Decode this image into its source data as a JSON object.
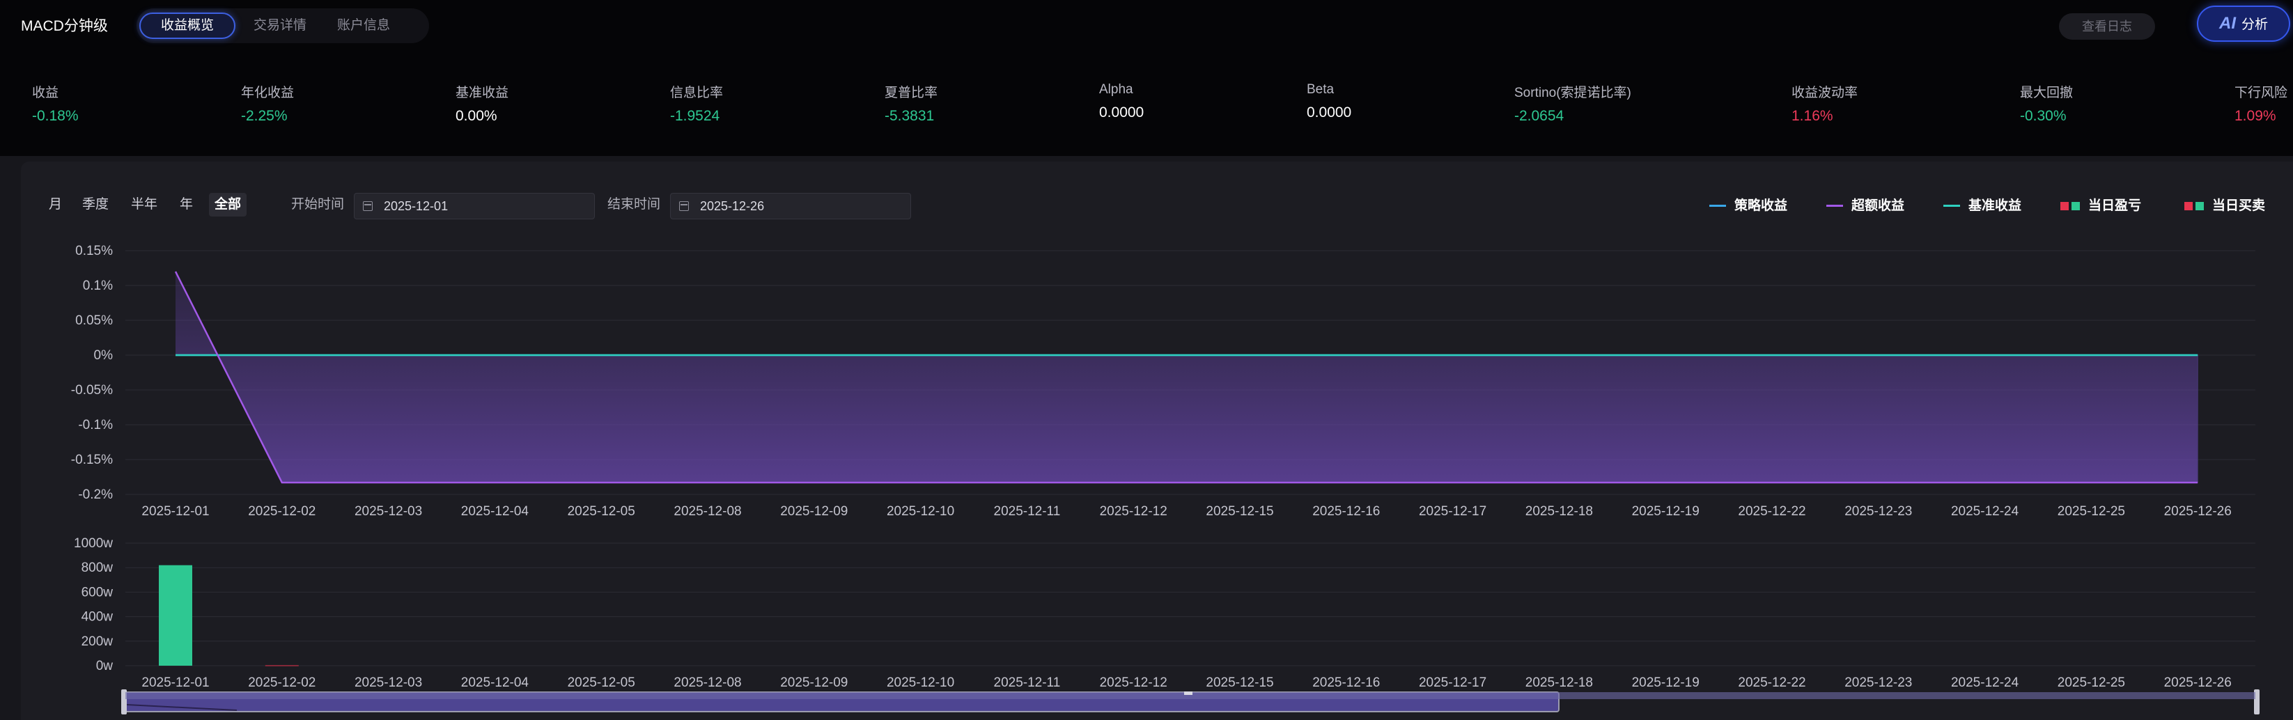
{
  "app": {
    "title": "MACD分钟级",
    "tabs": [
      {
        "label": "收益概览",
        "active": true
      },
      {
        "label": "交易详情",
        "active": false
      },
      {
        "label": "账户信息",
        "active": false
      }
    ],
    "log_button": "查看日志",
    "ai_button": {
      "glyph": "AI",
      "label": "分析"
    }
  },
  "metrics": [
    {
      "label": "收益",
      "value": "-0.18%",
      "tone": "green"
    },
    {
      "label": "年化收益",
      "value": "-2.25%",
      "tone": "green"
    },
    {
      "label": "基准收益",
      "value": "0.00%",
      "tone": "white"
    },
    {
      "label": "信息比率",
      "value": "-1.9524",
      "tone": "green"
    },
    {
      "label": "夏普比率",
      "value": "-5.3831",
      "tone": "green"
    },
    {
      "label": "Alpha",
      "value": "0.0000",
      "tone": "white"
    },
    {
      "label": "Beta",
      "value": "0.0000",
      "tone": "white"
    },
    {
      "label": "Sortino(索提诺比率)",
      "value": "-2.0654",
      "tone": "green"
    },
    {
      "label": "收益波动率",
      "value": "1.16%",
      "tone": "red"
    },
    {
      "label": "最大回撤",
      "value": "-0.30%",
      "tone": "green"
    },
    {
      "label": "下行风险",
      "value": "1.09%",
      "tone": "red"
    }
  ],
  "filters": {
    "periods": [
      {
        "label": "月",
        "active": false
      },
      {
        "label": "季度",
        "active": false
      },
      {
        "label": "半年",
        "active": false
      },
      {
        "label": "年",
        "active": false
      },
      {
        "label": "全部",
        "active": true
      }
    ],
    "start_label": "开始时间",
    "start_date": "2025-12-01",
    "end_label": "结束时间",
    "end_date": "2025-12-26"
  },
  "legend": [
    {
      "label": "策略收益",
      "kind": "line",
      "colors": [
        "#3aa7e8"
      ]
    },
    {
      "label": "超额收益",
      "kind": "line",
      "colors": [
        "#a259e8"
      ]
    },
    {
      "label": "基准收益",
      "kind": "line",
      "colors": [
        "#2fd0c0"
      ]
    },
    {
      "label": "当日盈亏",
      "kind": "squares",
      "colors": [
        "#e8344e",
        "#2ec892"
      ]
    },
    {
      "label": "当日买卖",
      "kind": "squares",
      "colors": [
        "#e8344e",
        "#2ec892"
      ]
    }
  ],
  "colors": {
    "strategy": "#3aa7e8",
    "excess": "#a259e8",
    "benchmark": "#2fd0c0",
    "bar_up": "#2ec892",
    "bar_down": "#e8344e"
  },
  "chart_data": [
    {
      "type": "line",
      "x": [
        "2025-12-01",
        "2025-12-02",
        "2025-12-03",
        "2025-12-04",
        "2025-12-05",
        "2025-12-08",
        "2025-12-09",
        "2025-12-10",
        "2025-12-11",
        "2025-12-12",
        "2025-12-15",
        "2025-12-16",
        "2025-12-17",
        "2025-12-18",
        "2025-12-19",
        "2025-12-22",
        "2025-12-23",
        "2025-12-24",
        "2025-12-25",
        "2025-12-26"
      ],
      "ylim": [
        -0.2,
        0.15
      ],
      "yticks": [
        "0.15%",
        "0.1%",
        "0.05%",
        "0%",
        "-0.05%",
        "-0.1%",
        "-0.15%",
        "-0.2%"
      ],
      "ytick_values": [
        0.15,
        0.1,
        0.05,
        0,
        -0.05,
        -0.1,
        -0.15,
        -0.2
      ],
      "grid": true,
      "series": [
        {
          "name": "策略收益",
          "values": [
            0,
            0,
            0,
            0,
            0,
            0,
            0,
            0,
            0,
            0,
            0,
            0,
            0,
            0,
            0,
            0,
            0,
            0,
            0,
            0
          ]
        },
        {
          "name": "超额收益",
          "values": [
            0.12,
            -0.183,
            -0.183,
            -0.183,
            -0.183,
            -0.183,
            -0.183,
            -0.183,
            -0.183,
            -0.183,
            -0.183,
            -0.183,
            -0.183,
            -0.183,
            -0.183,
            -0.183,
            -0.183,
            -0.183,
            -0.183,
            -0.183
          ]
        },
        {
          "name": "基准收益",
          "values": [
            0,
            0,
            0,
            0,
            0,
            0,
            0,
            0,
            0,
            0,
            0,
            0,
            0,
            0,
            0,
            0,
            0,
            0,
            0,
            0
          ]
        }
      ]
    },
    {
      "type": "bar",
      "categories": [
        "2025-12-01",
        "2025-12-02",
        "2025-12-03",
        "2025-12-04",
        "2025-12-05",
        "2025-12-08",
        "2025-12-09",
        "2025-12-10",
        "2025-12-11",
        "2025-12-12",
        "2025-12-15",
        "2025-12-16",
        "2025-12-17",
        "2025-12-18",
        "2025-12-19",
        "2025-12-22",
        "2025-12-23",
        "2025-12-24",
        "2025-12-25",
        "2025-12-26"
      ],
      "ylim": [
        0,
        1000
      ],
      "yticks": [
        "1000w",
        "800w",
        "600w",
        "400w",
        "200w",
        "0w"
      ],
      "ytick_values": [
        1000,
        800,
        600,
        400,
        200,
        0
      ],
      "grid": true,
      "values": [
        820,
        3,
        0,
        0,
        0,
        0,
        0,
        0,
        0,
        0,
        0,
        0,
        0,
        0,
        0,
        0,
        0,
        0,
        0,
        0
      ],
      "value_sign": [
        "up",
        "down",
        "up",
        "up",
        "up",
        "up",
        "up",
        "up",
        "up",
        "up",
        "up",
        "up",
        "up",
        "up",
        "up",
        "up",
        "up",
        "up",
        "up",
        "up"
      ]
    }
  ]
}
